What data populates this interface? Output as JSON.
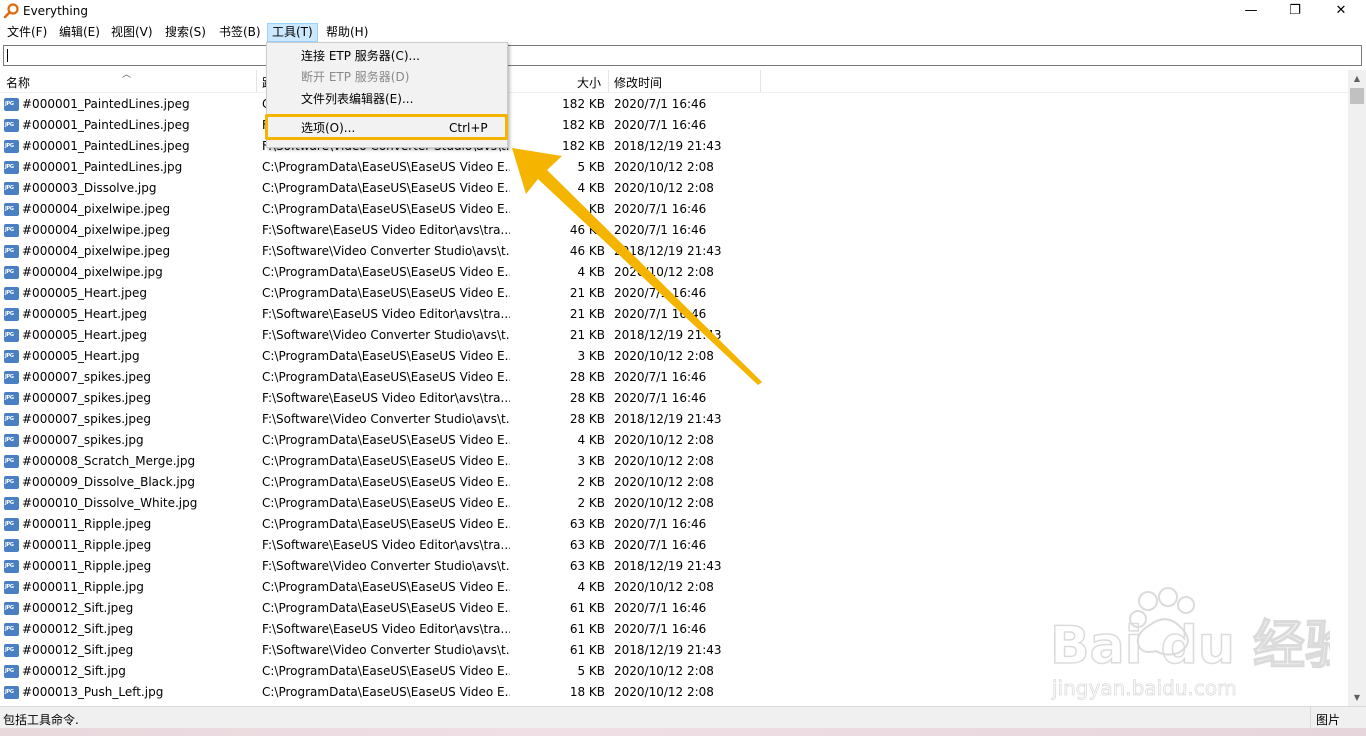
{
  "window": {
    "title": "Everything",
    "minimize_label": "—",
    "maximize_label": "❐",
    "close_label": "✕"
  },
  "menubar": [
    {
      "label": "文件(F)"
    },
    {
      "label": "编辑(E)"
    },
    {
      "label": "视图(V)"
    },
    {
      "label": "搜索(S)"
    },
    {
      "label": "书签(B)"
    },
    {
      "label": "工具(T)"
    },
    {
      "label": "帮助(H)"
    }
  ],
  "search": {
    "value": ""
  },
  "columns": {
    "name": "名称",
    "path": "路",
    "size": "大小",
    "date": "修改时间"
  },
  "tools_menu": {
    "items": [
      {
        "label": "连接 ETP 服务器(C)...",
        "shortcut": "",
        "disabled": false
      },
      {
        "label": "断开 ETP 服务器(D)",
        "shortcut": "",
        "disabled": true
      },
      {
        "label": "文件列表编辑器(E)...",
        "shortcut": "",
        "disabled": false
      },
      {
        "label": "选项(O)...",
        "shortcut": "Ctrl+P",
        "disabled": false
      }
    ]
  },
  "rows": [
    {
      "name": "#000001_PaintedLines.jpeg",
      "path": "C",
      "size": "182 KB",
      "date": "2020/7/1 16:46"
    },
    {
      "name": "#000001_PaintedLines.jpeg",
      "path": "F",
      "size": "182 KB",
      "date": "2020/7/1 16:46"
    },
    {
      "name": "#000001_PaintedLines.jpeg",
      "path": "F:\\Software\\Video Converter Studio\\avs\\t...",
      "size": "182 KB",
      "date": "2018/12/19 21:43"
    },
    {
      "name": "#000001_PaintedLines.jpg",
      "path": "C:\\ProgramData\\EaseUS\\EaseUS Video E...",
      "size": "5 KB",
      "date": "2020/10/12 2:08"
    },
    {
      "name": "#000003_Dissolve.jpg",
      "path": "C:\\ProgramData\\EaseUS\\EaseUS Video E...",
      "size": "4 KB",
      "date": "2020/10/12 2:08"
    },
    {
      "name": "#000004_pixelwipe.jpeg",
      "path": "C:\\ProgramData\\EaseUS\\EaseUS Video E...",
      "size": "KB",
      "date": "2020/7/1 16:46"
    },
    {
      "name": "#000004_pixelwipe.jpeg",
      "path": "F:\\Software\\EaseUS Video Editor\\avs\\tra...",
      "size": "46 KB",
      "date": "2020/7/1 16:46"
    },
    {
      "name": "#000004_pixelwipe.jpeg",
      "path": "F:\\Software\\Video Converter Studio\\avs\\t...",
      "size": "46 KB",
      "date": "2018/12/19 21:43"
    },
    {
      "name": "#000004_pixelwipe.jpg",
      "path": "C:\\ProgramData\\EaseUS\\EaseUS Video E...",
      "size": "4 KB",
      "date": "2020/10/12 2:08"
    },
    {
      "name": "#000005_Heart.jpeg",
      "path": "C:\\ProgramData\\EaseUS\\EaseUS Video E...",
      "size": "21 KB",
      "date": "2020/7/1 16:46"
    },
    {
      "name": "#000005_Heart.jpeg",
      "path": "F:\\Software\\EaseUS Video Editor\\avs\\tra...",
      "size": "21 KB",
      "date": "2020/7/1 16:46"
    },
    {
      "name": "#000005_Heart.jpeg",
      "path": "F:\\Software\\Video Converter Studio\\avs\\t...",
      "size": "21 KB",
      "date": "2018/12/19 21:43"
    },
    {
      "name": "#000005_Heart.jpg",
      "path": "C:\\ProgramData\\EaseUS\\EaseUS Video E...",
      "size": "3 KB",
      "date": "2020/10/12 2:08"
    },
    {
      "name": "#000007_spikes.jpeg",
      "path": "C:\\ProgramData\\EaseUS\\EaseUS Video E...",
      "size": "28 KB",
      "date": "2020/7/1 16:46"
    },
    {
      "name": "#000007_spikes.jpeg",
      "path": "F:\\Software\\EaseUS Video Editor\\avs\\tra...",
      "size": "28 KB",
      "date": "2020/7/1 16:46"
    },
    {
      "name": "#000007_spikes.jpeg",
      "path": "F:\\Software\\Video Converter Studio\\avs\\t...",
      "size": "28 KB",
      "date": "2018/12/19 21:43"
    },
    {
      "name": "#000007_spikes.jpg",
      "path": "C:\\ProgramData\\EaseUS\\EaseUS Video E...",
      "size": "4 KB",
      "date": "2020/10/12 2:08"
    },
    {
      "name": "#000008_Scratch_Merge.jpg",
      "path": "C:\\ProgramData\\EaseUS\\EaseUS Video E...",
      "size": "3 KB",
      "date": "2020/10/12 2:08"
    },
    {
      "name": "#000009_Dissolve_Black.jpg",
      "path": "C:\\ProgramData\\EaseUS\\EaseUS Video E...",
      "size": "2 KB",
      "date": "2020/10/12 2:08"
    },
    {
      "name": "#000010_Dissolve_White.jpg",
      "path": "C:\\ProgramData\\EaseUS\\EaseUS Video E...",
      "size": "2 KB",
      "date": "2020/10/12 2:08"
    },
    {
      "name": "#000011_Ripple.jpeg",
      "path": "C:\\ProgramData\\EaseUS\\EaseUS Video E...",
      "size": "63 KB",
      "date": "2020/7/1 16:46"
    },
    {
      "name": "#000011_Ripple.jpeg",
      "path": "F:\\Software\\EaseUS Video Editor\\avs\\tra...",
      "size": "63 KB",
      "date": "2020/7/1 16:46"
    },
    {
      "name": "#000011_Ripple.jpeg",
      "path": "F:\\Software\\Video Converter Studio\\avs\\t...",
      "size": "63 KB",
      "date": "2018/12/19 21:43"
    },
    {
      "name": "#000011_Ripple.jpg",
      "path": "C:\\ProgramData\\EaseUS\\EaseUS Video E...",
      "size": "4 KB",
      "date": "2020/10/12 2:08"
    },
    {
      "name": "#000012_Sift.jpeg",
      "path": "C:\\ProgramData\\EaseUS\\EaseUS Video E...",
      "size": "61 KB",
      "date": "2020/7/1 16:46"
    },
    {
      "name": "#000012_Sift.jpeg",
      "path": "F:\\Software\\EaseUS Video Editor\\avs\\tra...",
      "size": "61 KB",
      "date": "2020/7/1 16:46"
    },
    {
      "name": "#000012_Sift.jpeg",
      "path": "F:\\Software\\Video Converter Studio\\avs\\t...",
      "size": "61 KB",
      "date": "2018/12/19 21:43"
    },
    {
      "name": "#000012_Sift.jpg",
      "path": "C:\\ProgramData\\EaseUS\\EaseUS Video E...",
      "size": "5 KB",
      "date": "2020/10/12 2:08"
    },
    {
      "name": "#000013_Push_Left.jpg",
      "path": "C:\\ProgramData\\EaseUS\\EaseUS Video E...",
      "size": "18 KB",
      "date": "2020/10/12 2:08"
    }
  ],
  "status": {
    "text": "包括工具命令.",
    "right": "图片"
  },
  "watermark": {
    "brand": "Bai du 经验",
    "url": "jingyan.baidu.com"
  },
  "colors": {
    "highlight": "#f5b400",
    "menu_active": "#cce8ff",
    "icon_blue": "#4a7fc4"
  }
}
